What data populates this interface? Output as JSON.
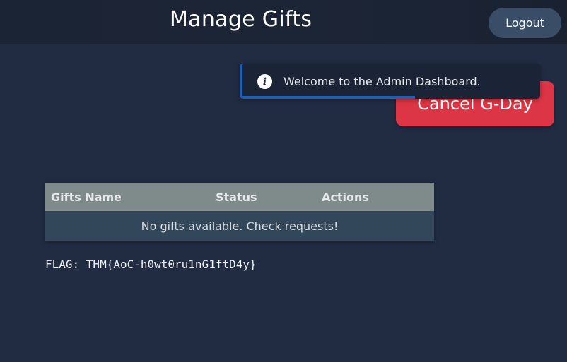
{
  "header": {
    "title": "Manage Gifts",
    "logout_label": "Logout"
  },
  "actions": {
    "cancel_label": "Cancel G-Day",
    "cancel_color": "#dc3545"
  },
  "toast": {
    "icon": "info-icon",
    "message": "Welcome to the Admin Dashboard.",
    "progress_fraction": 0.58,
    "accent_color": "#1e5fb8"
  },
  "table": {
    "columns": [
      "Gifts Name",
      "Status",
      "Actions"
    ],
    "empty_message": "No gifts available. Check requests!"
  },
  "flag": {
    "text": "FLAG: THM{AoC-h0wt0ru1nG1ftD4y}"
  }
}
